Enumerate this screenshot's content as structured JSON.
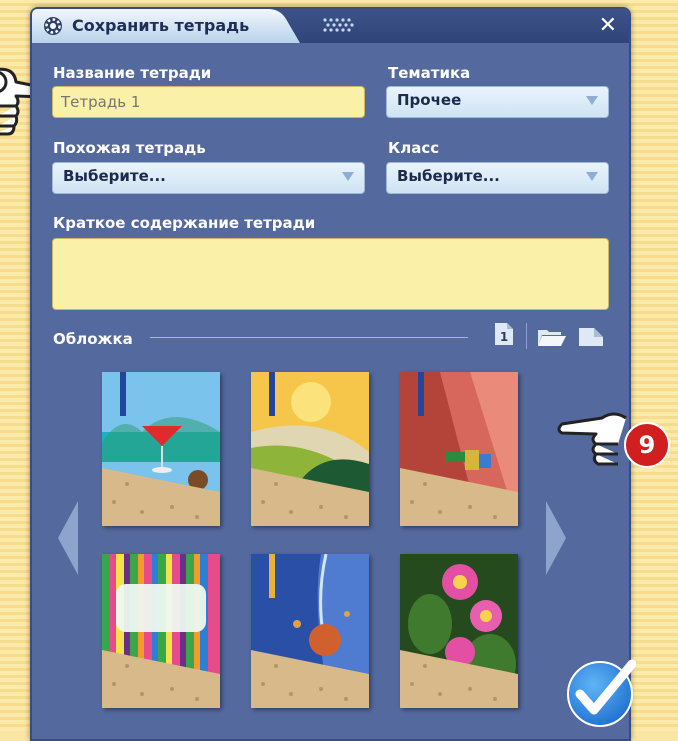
{
  "dialog": {
    "title": "Сохранить тетрадь",
    "close_label": "✕"
  },
  "form": {
    "name_label": "Название тетради",
    "name_placeholder": "Тетрадь 1",
    "theme_label": "Тематика",
    "theme_value": "Прочее",
    "similar_label": "Похожая тетрадь",
    "similar_value": "Выберите...",
    "class_label": "Класс",
    "class_value": "Выберите...",
    "summary_label": "Краткое содержание тетради",
    "summary_value": ""
  },
  "cover": {
    "label": "Обложка",
    "page_number": "1",
    "thumbnails": [
      {
        "name": "cover-cocktail-beach",
        "colors": [
          "#6fb9e6",
          "#1aa4b0"
        ]
      },
      {
        "name": "cover-yellow-green-arcs",
        "colors": [
          "#f6c23e",
          "#2f6e2f"
        ]
      },
      {
        "name": "cover-terracotta-fish",
        "colors": [
          "#b4443a",
          "#e0776a"
        ]
      },
      {
        "name": "cover-color-stripes",
        "colors": [
          "#3aa64a",
          "#e84b8a"
        ]
      },
      {
        "name": "cover-blue-splash",
        "colors": [
          "#2a4fa6",
          "#d05a2b"
        ]
      },
      {
        "name": "cover-pink-peonies",
        "colors": [
          "#2f5a24",
          "#e04ea3"
        ]
      }
    ]
  },
  "badge_number": "9",
  "icons": [
    "gear-icon",
    "grip-icon",
    "close-icon",
    "page-icon",
    "folder-icon",
    "blank-page-icon",
    "pointing-hand-icon",
    "check-icon"
  ]
}
